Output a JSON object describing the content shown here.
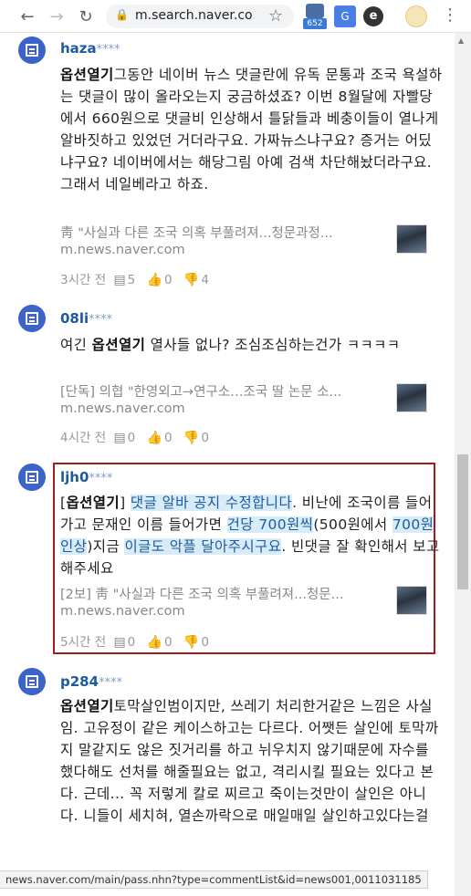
{
  "browser": {
    "url": "m.search.naver.co...",
    "extension_badge": "652",
    "status_url": "news.naver.com/main/pass.nhn?type=commentList&id=news001,0011031185"
  },
  "comments": [
    {
      "nick": "haza",
      "mask": "****",
      "keyword": "옵션열기",
      "text": "그동안 네이버 뉴스 댓글란에 유독 문통과 조국 욕설하는 댓글이 많이 올라오는지 궁금하셨죠? 이번 8월달에 자빨당에서 660원으로 댓글비 인상해서 틀닭들과 베충이들이 열나게 알바짓하고 있었던 거더라구요. 가짜뉴스냐구요? 증거는 어딨냐구요? 네이버에서는 해당그림 아예 검색 차단해놨더라구요. 그래서 네일베라고 하죠.",
      "link_title": "靑 \"사실과 다른 조국 의혹 부풀려져...청문과정...",
      "link_domain": "m.news.naver.com",
      "time": "3시간 전",
      "replies": "5",
      "likes": "0",
      "dislikes": "4"
    },
    {
      "nick": "08li",
      "mask": "****",
      "pre": "여긴 ",
      "keyword": "옵션열기",
      "text": " 열사들 없나? 조심조심하는건가 ㅋㅋㅋㅋ",
      "link_title": "[단독] 의협 \"한영외고→연구소…조국 딸 논문 소...",
      "link_domain": "m.news.naver.com",
      "time": "4시간 전",
      "replies": "0",
      "likes": "0",
      "dislikes": "0"
    },
    {
      "nick": "ljh0",
      "mask": "****",
      "part1": "[",
      "keyword": "옵션열기",
      "part2": "] ",
      "hl1": "댓글 알바 공지 수정합니다",
      "part3": ". 비난에 조국이름 들어가고 문재인 이름 들어가면 ",
      "hl2": "건당 700원씩",
      "part4": "(500원에서 ",
      "hl3": "700원 인상",
      "part5": ")지금 ",
      "hl4": "이글도 악플 달아주시구요",
      "part6": ". 빈댓글 잘 확인해서 보고해주세요",
      "link_title": "[2보] 靑 \"사실과 다른 조국 의혹 부풀려져...청문...",
      "link_domain": "m.news.naver.com",
      "time": "5시간 전",
      "replies": "0",
      "likes": "0",
      "dislikes": "0"
    },
    {
      "nick": "p284",
      "mask": "****",
      "keyword": "옵션열기",
      "text": "토막살인범이지만, 쓰레기 처리한거같은 느낌은 사실임. 고유정이 같은 케이스하고는 다르다. 어쨋든 살인에 토막까지 말같지도 않은 짓거리를 하고 뉘우치지 않기때문에 자수를 했다해도 선처를 해줄필요는 없고, 격리시킬 필요는 있다고 본다. 근데... 꼭 저렇게 칼로 찌르고 죽이는것만이 살인은 아니다. 니들이 세치혀, 열손까락으로 매일매일 살인하고있다는걸"
    }
  ]
}
